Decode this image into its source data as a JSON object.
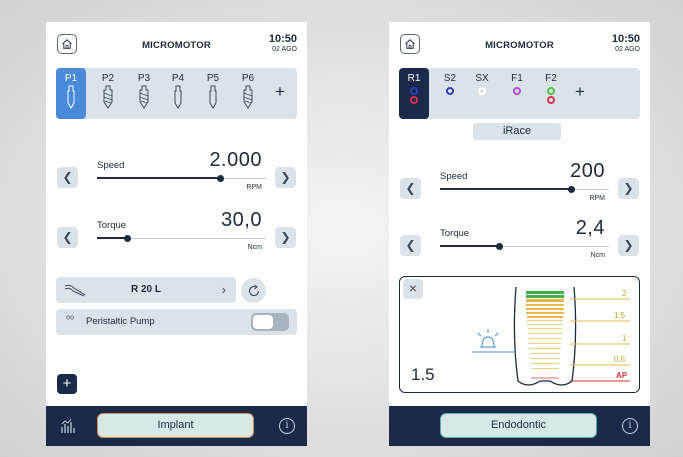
{
  "screen_implant": {
    "title": "MICROMOTOR",
    "time": "10:50",
    "date": "02 AGO",
    "programs": [
      "P1",
      "P2",
      "P3",
      "P4",
      "P5",
      "P6"
    ],
    "add_program": "+",
    "speed": {
      "label": "Speed",
      "value": "2.000",
      "unit": "RPM",
      "level": 0.73
    },
    "torque": {
      "label": "Torque",
      "value": "30,0",
      "unit": "Ncm",
      "level": 0.18
    },
    "ratio": "R 20 L",
    "pump_label": "Peristaltic Pump",
    "pump_on": false,
    "add_button": "+",
    "mode": "Implant",
    "info": "i"
  },
  "screen_endo": {
    "title": "MICROMOTOR",
    "time": "10:50",
    "date": "02 AGO",
    "files": [
      "R1",
      "S2",
      "SX",
      "F1",
      "F2"
    ],
    "add_file": "+",
    "file_name": "iRace",
    "speed": {
      "label": "Speed",
      "value": "200",
      "unit": "RPM",
      "level": 0.78
    },
    "torque": {
      "label": "Torque",
      "value": "2,4",
      "unit": "Ncm",
      "level": 0.35
    },
    "apex_ticks": [
      "2",
      "1.5",
      "1",
      "0.5",
      "AP"
    ],
    "apex_reading": "1.5",
    "close": "×",
    "mode": "Endodontic",
    "info": "i"
  },
  "colors": {
    "accent_blue": "#4a8ad9",
    "navy": "#1b2a4a",
    "panel": "#dbe3ea",
    "implant_outline": "#d98a55",
    "endo_outline": "#55b0a8",
    "ring_blue": "#2a3fb8",
    "ring_red": "#e0314e",
    "ring_white": "#ffffff",
    "ring_purple": "#b04fd6",
    "ring_green": "#55c24a",
    "apex_green": "#3db34a",
    "apex_yellow": "#e9b84b",
    "apex_red": "#d23b3b"
  }
}
